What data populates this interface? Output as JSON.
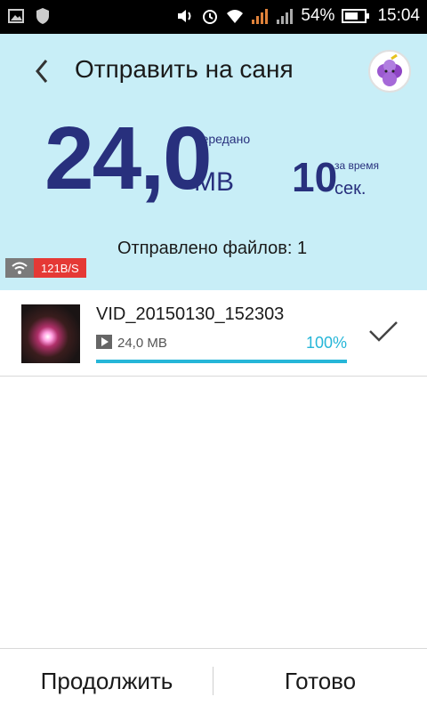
{
  "statusbar": {
    "battery_percent": "54%",
    "time": "15:04",
    "icons": [
      "image-icon",
      "shield-icon",
      "volume-icon",
      "alarm-icon",
      "wifi-icon",
      "signal-icon",
      "signal-icon",
      "battery-icon"
    ]
  },
  "header": {
    "title": "Отправить на саня",
    "transferred_value": "24,0",
    "transferred_caption": "передано",
    "transferred_unit": "MB",
    "time_value": "10",
    "time_caption": "за время",
    "time_unit": "сек.",
    "files_sent": "Отправлено файлов: 1",
    "speed": "121B/S",
    "accent_color": "#28307d",
    "background_color": "#c8eef7"
  },
  "file": {
    "name": "VID_20150130_152303",
    "size": "24,0 MB",
    "percent_label": "100%",
    "progress_fraction": 1.0,
    "progress_color": "#26b6d8"
  },
  "footer": {
    "continue_label": "Продолжить",
    "done_label": "Готово"
  }
}
